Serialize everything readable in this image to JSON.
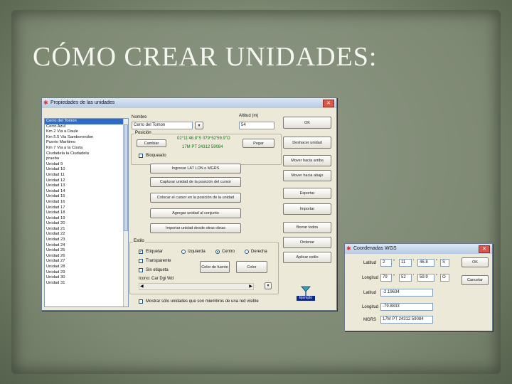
{
  "slide": {
    "title": "CÓMO CREAR UNIDADES:"
  },
  "main_window": {
    "title": "Propiedades de las unidades",
    "units": [
      "Cerro del Tomon",
      "Cerro Azul",
      "Km 2 Via a Daule",
      "Km 5.5 Via Samborondon",
      "Puerto Marítimo",
      "Km 7 Via a la Costa",
      "Ciudadela la Ciudadela",
      "prueba",
      "Unidad 9",
      "Unidad 10",
      "Unidad 11",
      "Unidad 12",
      "Unidad 13",
      "Unidad 14",
      "Unidad 15",
      "Unidad 16",
      "Unidad 17",
      "Unidad 18",
      "Unidad 19",
      "Unidad 20",
      "Unidad 21",
      "Unidad 22",
      "Unidad 23",
      "Unidad 24",
      "Unidad 25",
      "Unidad 26",
      "Unidad 27",
      "Unidad 28",
      "Unidad 29",
      "Unidad 30",
      "Unidad 31"
    ],
    "nombre_label": "Nombre",
    "nombre_value": "Cerro del Tomon",
    "altitud_label": "Altitud (m)",
    "altitud_value": "54",
    "posicion_label": "Posición",
    "coords_line1": "02°11'46.8\"S 079°52'59.9\"O",
    "coords_line2": "17M PT 24312 59084",
    "cambiar_btn": "Cambiar",
    "pegar_btn": "Pegar",
    "bloqueado_label": "Bloqueado",
    "buttons_center": [
      "Ingresar LAT LON o MGRS",
      "Capturar unidad de la posición del cursor",
      "Colocar el cursor en la posición de la unidad",
      "Agregar unidad al conjunto",
      "Importar unidad desde otras obras"
    ],
    "estilo_label": "Estilo",
    "estilo_checks": [
      "Etiquetar",
      "Transparente",
      "Sin etiqueta"
    ],
    "radios": [
      "Izquierda",
      "Centro",
      "Derecha"
    ],
    "color_fuente_btn": "Color de fuente",
    "color_btn": "Color",
    "icono_label": "Icono: Car Dgi Wd",
    "icon_caption": "Ejemplo",
    "mostrar_label": "Mostrar sólo unidades que son miembros de una red visible",
    "right_buttons": [
      "OK",
      "Deshacer unidad",
      "Mover hacia arriba",
      "Mover hacia abajo",
      "Exportar",
      "Importar",
      "Borrar todos",
      "Ordenar",
      "Aplicar estilo"
    ]
  },
  "coord_window": {
    "title": "Coordenadas WGS",
    "latitud_label": "Latitud",
    "longitud_label": "Longitud",
    "lat": [
      "2",
      "11",
      "46.8"
    ],
    "lat_hem": "S",
    "lon": [
      "79",
      "52",
      "59.9"
    ],
    "lon_hem": "O",
    "lat_dec_label": "Latitud",
    "lat_dec": "-2.19634",
    "lon_dec_label": "Longitud",
    "lon_dec": "-79.8833",
    "mgrs_label": "MGRS",
    "mgrs": "17M PT 24312 59084",
    "ok_btn": "OK",
    "cancel_btn": "Cancelar"
  }
}
